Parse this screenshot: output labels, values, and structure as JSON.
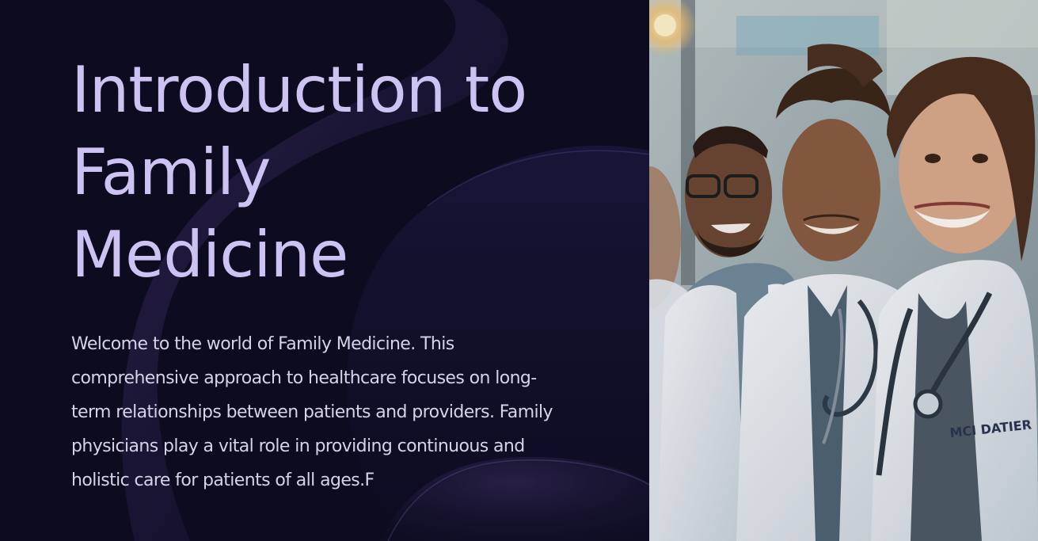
{
  "slide": {
    "title_lines": [
      "Introduction to",
      "Family",
      "Medicine"
    ],
    "body_lines": [
      "Welcome to the world of Family Medicine. This",
      "comprehensive approach to healthcare focuses on long-",
      "term relationships between patients and providers. Family",
      "physicians play a vital role in providing continuous and",
      "holistic care for patients of all ages.F"
    ],
    "photo": {
      "subject": "group of smiling doctors in white coats with stethoscopes",
      "coat_text": "MCI DATIER"
    }
  },
  "colors": {
    "background": "#0c0b20",
    "title": "#cdc3f2",
    "body_text": "#d6d2e8",
    "accent_wave": "#3a2a5e"
  }
}
